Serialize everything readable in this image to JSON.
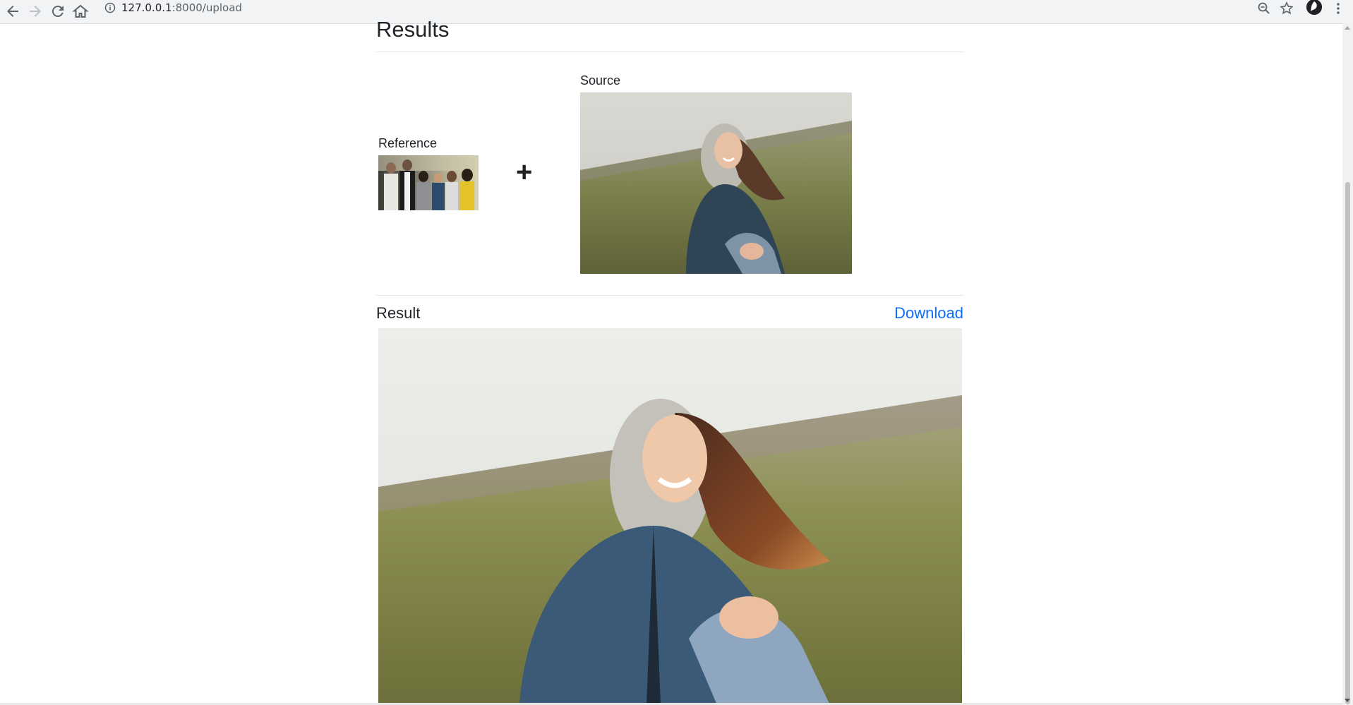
{
  "browser": {
    "url_host": "127.0.0.1",
    "url_rest": ":8000/upload",
    "icons": [
      "back-arrow-icon",
      "forward-arrow-icon",
      "reload-icon",
      "home-icon",
      "info-icon",
      "zoom-icon",
      "bookmark-star-icon",
      "profile-avatar-icon",
      "kebab-menu-icon"
    ]
  },
  "page": {
    "title": "Results",
    "reference_label": "Reference",
    "plus_symbol": "+",
    "source_label": "Source",
    "result_label": "Result",
    "download_label": "Download"
  },
  "colors": {
    "link": "#0d6efd",
    "text": "#212529",
    "rule": "#e5e5e5"
  }
}
